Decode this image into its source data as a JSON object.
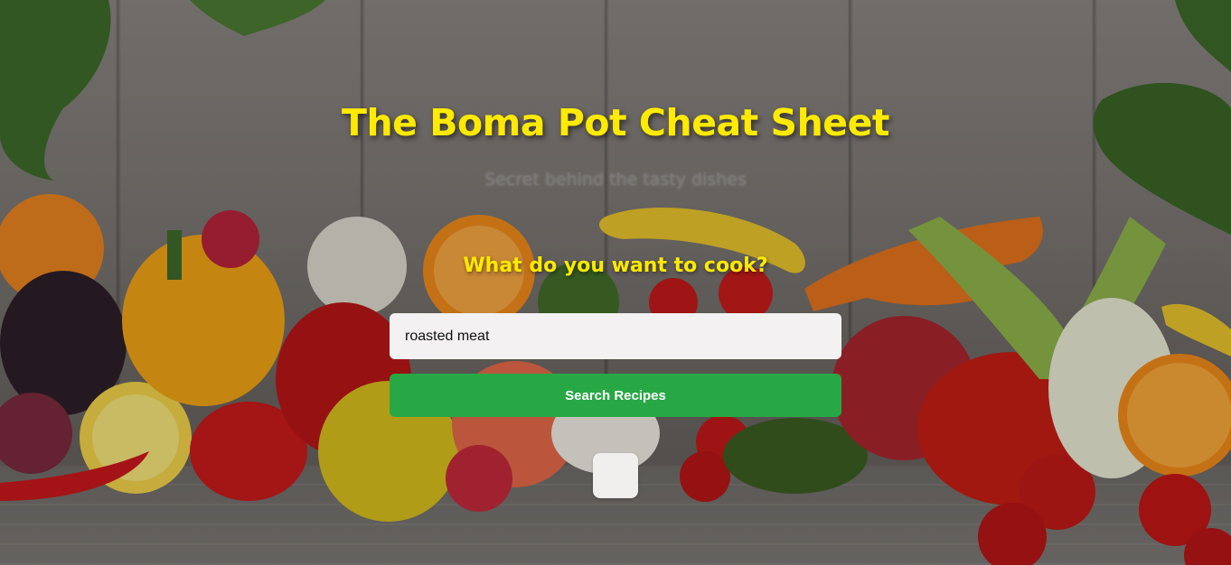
{
  "page": {
    "title": "The Boma Pot Cheat Sheet",
    "subtitle": "Secret behind the tasty dishes",
    "question": "What do you want to cook?"
  },
  "search": {
    "value": "roasted meat",
    "button_label": "Search Recipes"
  },
  "colors": {
    "accent": "#ffea00",
    "button": "#27a844"
  },
  "background": {
    "image": "fresh-vegetables-on-wooden-table"
  }
}
